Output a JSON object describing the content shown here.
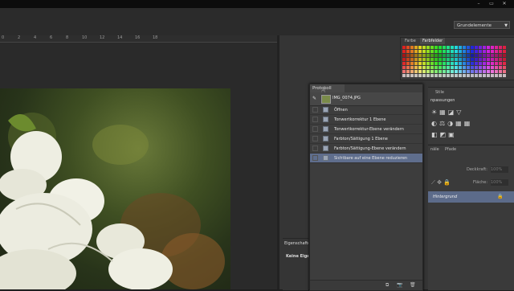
{
  "workspace": {
    "selected": "Grundelemente"
  },
  "ruler": {
    "ticks": [
      "0",
      "2",
      "4",
      "6",
      "8",
      "10",
      "12",
      "14",
      "16",
      "18"
    ]
  },
  "swatch_panel": {
    "tabs": [
      "Farbe",
      "Farbfelder"
    ]
  },
  "history_panel": {
    "tab": "Protokoll",
    "snapshot": "IMG_0074.JPG",
    "steps": [
      {
        "label": "Öffnen",
        "active": false
      },
      {
        "label": "Tonwertkorrektur 1 Ebene",
        "active": false
      },
      {
        "label": "Tonwertkorrektur-Ebene verändern",
        "active": false
      },
      {
        "label": "Farbton/Sättigung 1 Ebene",
        "active": false
      },
      {
        "label": "Farbton/Sättigung-Ebene verändern",
        "active": false
      },
      {
        "label": "Sichtbare auf eine Ebene reduzieren",
        "active": true
      }
    ]
  },
  "adjust_panel": {
    "tab": "Stile",
    "header": "npassungen"
  },
  "layers_panel": {
    "tabs": [
      "näle",
      "Pfade"
    ],
    "opacity_label": "Deckkraft:",
    "opacity_value": "100%",
    "fill_label": "Fläche:",
    "fill_value": "100%",
    "layer_name": "Hintergrund"
  },
  "properties_panel": {
    "tab": "Eigenschaften",
    "text": "Keine Eigenschaften"
  }
}
